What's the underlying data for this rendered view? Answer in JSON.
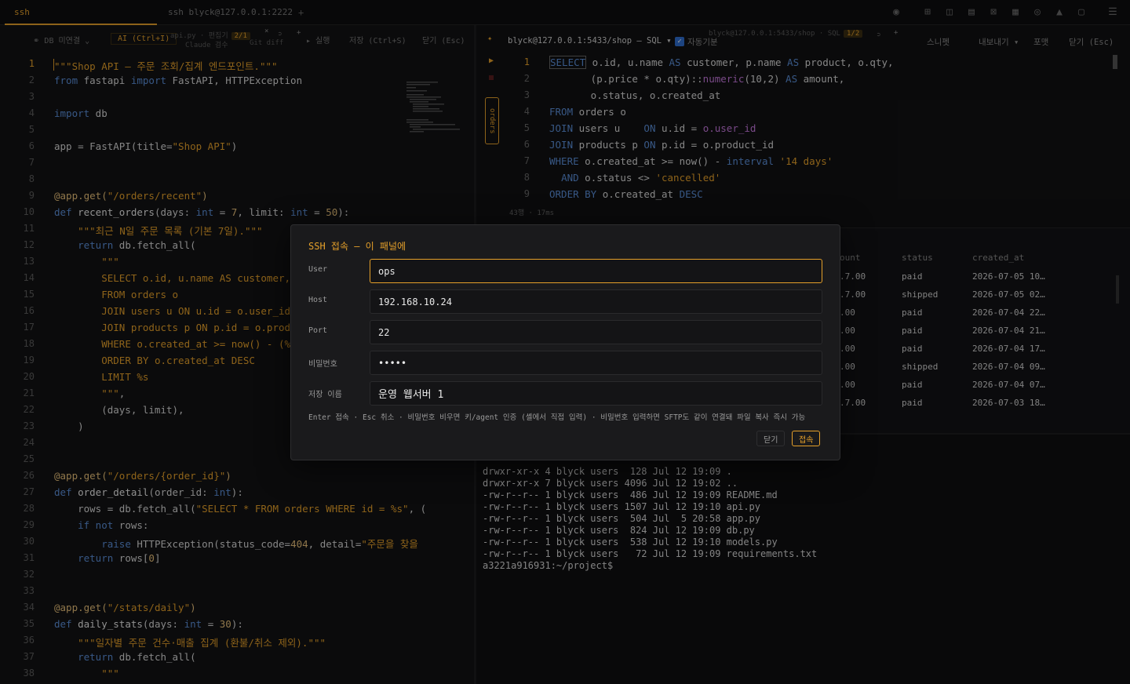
{
  "tabs": [
    {
      "label": "ssh blyck@127.0.0.1:2222",
      "close": "×"
    },
    {
      "label": "ssh blyck@127.0.0.1:2222"
    }
  ],
  "tab_plus": "+",
  "left_toolbar": {
    "db_disconnect": "DB 미연결",
    "ai": "AI (Ctrl+I)",
    "file": "api.py · 편집기",
    "file_badge": "2/1",
    "close_x": "×",
    "plus": "+",
    "run": "▸ 실행",
    "save": "저장 (Ctrl+S)",
    "close": "닫기 (Esc)",
    "ghost_claude": "Claude 검수",
    "ghost_git": "Git diff"
  },
  "code_lines": [
    {
      "n": "1",
      "html": "<span class=\"st\">\"\"\"Shop API — 주문 조회/집계 엔드포인트.\"\"\"</span>"
    },
    {
      "n": "2",
      "html": "<span class=\"kw\">from</span> fastapi <span class=\"kw\">import</span> FastAPI, HTTPException"
    },
    {
      "n": "3",
      "html": ""
    },
    {
      "n": "4",
      "html": "<span class=\"kw\">import</span> db"
    },
    {
      "n": "5",
      "html": ""
    },
    {
      "n": "6",
      "html": "app = FastAPI(title=<span class=\"st\">\"Shop API\"</span>)"
    },
    {
      "n": "7",
      "html": ""
    },
    {
      "n": "8",
      "html": ""
    },
    {
      "n": "9",
      "html": "<span class=\"dec\">@app.get(</span><span class=\"st\">\"/orders/recent\"</span><span class=\"dec\">)</span>"
    },
    {
      "n": "10",
      "html": "<span class=\"kw\">def</span> <span class=\"fn\">recent_orders</span>(days: <span class=\"kw\">int</span> = <span class=\"dec\">7</span>, limit: <span class=\"kw\">int</span> = <span class=\"dec\">50</span>):"
    },
    {
      "n": "11",
      "html": "    <span class=\"st\">\"\"\"최근 N일 주문 목록 (기본 7일).\"\"\"</span>"
    },
    {
      "n": "12",
      "html": "    <span class=\"kw\">return</span> db.fetch_all("
    },
    {
      "n": "13",
      "html": "        <span class=\"st\">\"\"\"</span>"
    },
    {
      "n": "14",
      "html": "        <span class=\"st\">SELECT o.id, u.name AS customer, p.</span>"
    },
    {
      "n": "15",
      "html": "        <span class=\"st\">FROM orders o</span>"
    },
    {
      "n": "16",
      "html": "        <span class=\"st\">JOIN users u ON u.id = o.user_id</span>"
    },
    {
      "n": "17",
      "html": "        <span class=\"st\">JOIN products p ON p.id = o.product</span>"
    },
    {
      "n": "18",
      "html": "        <span class=\"st\">WHERE o.created_at >= now() - (%s |</span>"
    },
    {
      "n": "19",
      "html": "        <span class=\"st\">ORDER BY o.created_at DESC</span>"
    },
    {
      "n": "20",
      "html": "        <span class=\"st\">LIMIT %s</span>"
    },
    {
      "n": "21",
      "html": "        <span class=\"st\">\"\"\"</span>,"
    },
    {
      "n": "22",
      "html": "        (days, limit),"
    },
    {
      "n": "23",
      "html": "    )"
    },
    {
      "n": "24",
      "html": ""
    },
    {
      "n": "25",
      "html": ""
    },
    {
      "n": "26",
      "html": "<span class=\"dec\">@app.get(</span><span class=\"st\">\"/orders/{order_id}\"</span><span class=\"dec\">)</span>"
    },
    {
      "n": "27",
      "html": "<span class=\"kw\">def</span> <span class=\"fn\">order_detail</span>(order_id: <span class=\"kw\">int</span>):"
    },
    {
      "n": "28",
      "html": "    rows = db.fetch_all(<span class=\"st\">\"SELECT * FROM orders WHERE id = %s\"</span>, ("
    },
    {
      "n": "29",
      "html": "    <span class=\"kw\">if not</span> rows:"
    },
    {
      "n": "30",
      "html": "        <span class=\"kw\">raise</span> HTTPException(status_code=<span class=\"dec\">404</span>, detail=<span class=\"st\">\"주문을 찾을</span>"
    },
    {
      "n": "31",
      "html": "    <span class=\"kw\">return</span> rows[<span class=\"dec\">0</span>]"
    },
    {
      "n": "32",
      "html": ""
    },
    {
      "n": "33",
      "html": ""
    },
    {
      "n": "34",
      "html": "<span class=\"dec\">@app.get(</span><span class=\"st\">\"/stats/daily\"</span><span class=\"dec\">)</span>"
    },
    {
      "n": "35",
      "html": "<span class=\"kw\">def</span> <span class=\"fn\">daily_stats</span>(days: <span class=\"kw\">int</span> = <span class=\"dec\">30</span>):"
    },
    {
      "n": "36",
      "html": "    <span class=\"st\">\"\"\"일자별 주문 건수·매출 집계 (환불/취소 제외).\"\"\"</span>"
    },
    {
      "n": "37",
      "html": "    <span class=\"kw\">return</span> db.fetch_all("
    },
    {
      "n": "38",
      "html": "        <span class=\"st\">\"\"\"</span>"
    }
  ],
  "sql_toolbar": {
    "conn": "blyck@127.0.0.1:5433/shop — SQL ▾",
    "auto": "자동기분",
    "ghost_conn": "blyck@127.0.0.1:5433/shop · SQL",
    "ghost_badge": "1/2",
    "snippet": "스니펫",
    "export": "내보내기 ▾",
    "format": "포맷",
    "close": "닫기 (Esc)",
    "plus": "+"
  },
  "orders_tab": "orders",
  "sql_lines": [
    {
      "n": "1",
      "html": "<span style=\"border:1px solid #666;color:#5b8fd8\">SELECT</span> o.id, u.name <span class=\"kw\">AS</span> customer, p.name <span class=\"kw\">AS</span> product, o.qty,"
    },
    {
      "n": "2",
      "html": "       (p.price * o.qty)::<span class=\"nm\">numeric</span>(10,2) <span class=\"kw\">AS</span> amount,"
    },
    {
      "n": "3",
      "html": "       o.status, o.created_at"
    },
    {
      "n": "4",
      "html": "<span class=\"kw\">FROM</span> orders o"
    },
    {
      "n": "5",
      "html": "<span class=\"kw\">JOIN</span> users u    <span class=\"kw\">ON</span> u.id = <span class=\"nm\">o.user_id</span>"
    },
    {
      "n": "6",
      "html": "<span class=\"kw\">JOIN</span> products p <span class=\"kw\">ON</span> p.id = o.product_id"
    },
    {
      "n": "7",
      "html": "<span class=\"kw\">WHERE</span> o.created_at >= now() - <span class=\"kw\">interval</span> <span class=\"sq\">'14 days'</span>"
    },
    {
      "n": "8",
      "html": "  <span class=\"kw\">AND</span> o.status <> <span class=\"sq\">'cancelled'</span>"
    },
    {
      "n": "9",
      "html": "<span class=\"kw\">ORDER BY</span> o.created_at <span class=\"kw\">DESC</span>"
    }
  ],
  "sql_status": "43행 · 17ms",
  "results": {
    "headers": [
      "ount",
      "status",
      "created_at"
    ],
    "rows": [
      [
        ".7.00",
        "paid",
        "2026-07-05 10…"
      ],
      [
        ".7.00",
        "shipped",
        "2026-07-05 02…"
      ],
      [
        ".00",
        "paid",
        "2026-07-04 22…"
      ],
      [
        ".00",
        "paid",
        "2026-07-04 21…"
      ],
      [
        ".00",
        "paid",
        "2026-07-04 17…"
      ],
      [
        ".00",
        "shipped",
        "2026-07-04 09…"
      ],
      [
        ".00",
        "paid",
        "2026-07-04 07…"
      ],
      [
        ".7.00",
        "paid",
        "2026-07-03 18…"
      ]
    ]
  },
  "terminal_lines": [
    "drwxr-xr-x 4 blyck users  128 Jul 12 19:09 .",
    "drwxr-xr-x 7 blyck users 4096 Jul 12 19:02 ..",
    "-rw-r--r-- 1 blyck users  486 Jul 12 19:09 README.md",
    "-rw-r--r-- 1 blyck users 1507 Jul 12 19:10 api.py",
    "-rw-r--r-- 1 blyck users  504 Jul  5 20:58 app.py",
    "-rw-r--r-- 1 blyck users  824 Jul 12 19:09 db.py",
    "-rw-r--r-- 1 blyck users  538 Jul 12 19:10 models.py",
    "-rw-r--r-- 1 blyck users   72 Jul 12 19:09 requirements.txt",
    "a3221a916931:~/project$"
  ],
  "modal": {
    "title": "SSH 접속 — 이 패널에",
    "user_label": "User",
    "user_value": "ops",
    "host_label": "Host",
    "host_value": "192.168.10.24",
    "port_label": "Port",
    "port_value": "22",
    "pw_label": "비밀번호",
    "pw_value": "•••••",
    "save_label": "저장 이름",
    "save_value": "운영 웹서버 1",
    "hint": "Enter 접속 · Esc 취소 · 비밀번호 비우면 키/agent 인증 (셸에서 직접 입력) · 비밀번호 입력하면 SFTP도 같이 연결돼 파일 복사 즉시 가능",
    "close_btn": "닫기",
    "connect_btn": "접속"
  },
  "colors": {
    "accent": "#e5a02a",
    "keyword": "#5b8fd8",
    "bg": "#111113"
  },
  "icons": [
    "camera-icon",
    "split-icon",
    "panel-icon",
    "close-box-icon",
    "table-icon",
    "globe-icon",
    "bookmark-icon",
    "window-icon",
    "menu-icon",
    "link-icon",
    "chevron-down-icon",
    "sparkle-icon",
    "play-icon",
    "stop-icon"
  ]
}
